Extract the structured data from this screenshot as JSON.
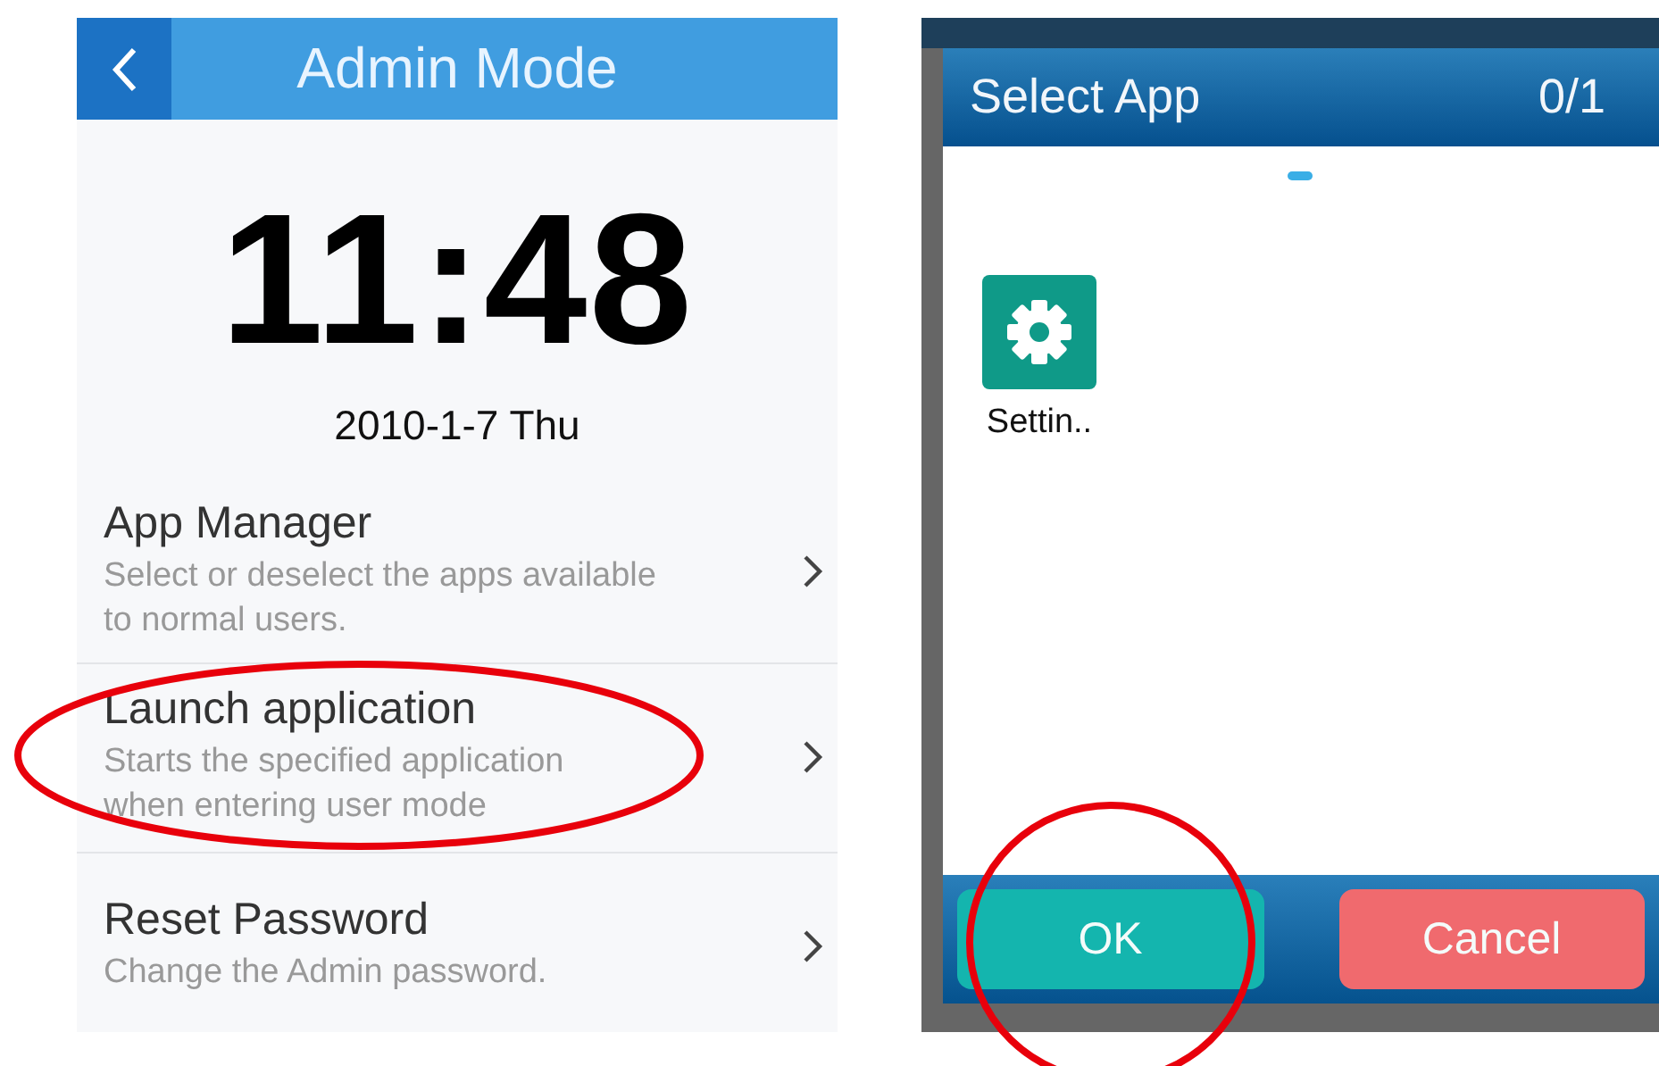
{
  "admin_screen": {
    "header": {
      "title": "Admin Mode"
    },
    "clock": "11:48",
    "date": "2010-1-7 Thu",
    "menu_items": [
      {
        "title": "App Manager",
        "description": "Select or deselect the apps available\nto normal users."
      },
      {
        "title": "Launch application",
        "description": "Starts the specified application\nwhen entering user mode"
      },
      {
        "title": "Reset Password",
        "description": "Change the Admin password."
      }
    ]
  },
  "select_app_dialog": {
    "title": "Select App",
    "counter": "0/1",
    "apps": [
      {
        "label": "Settin.."
      }
    ],
    "buttons": [
      {
        "label": "OK",
        "kind": "confirm"
      },
      {
        "label": "Cancel",
        "kind": "cancel"
      }
    ]
  }
}
